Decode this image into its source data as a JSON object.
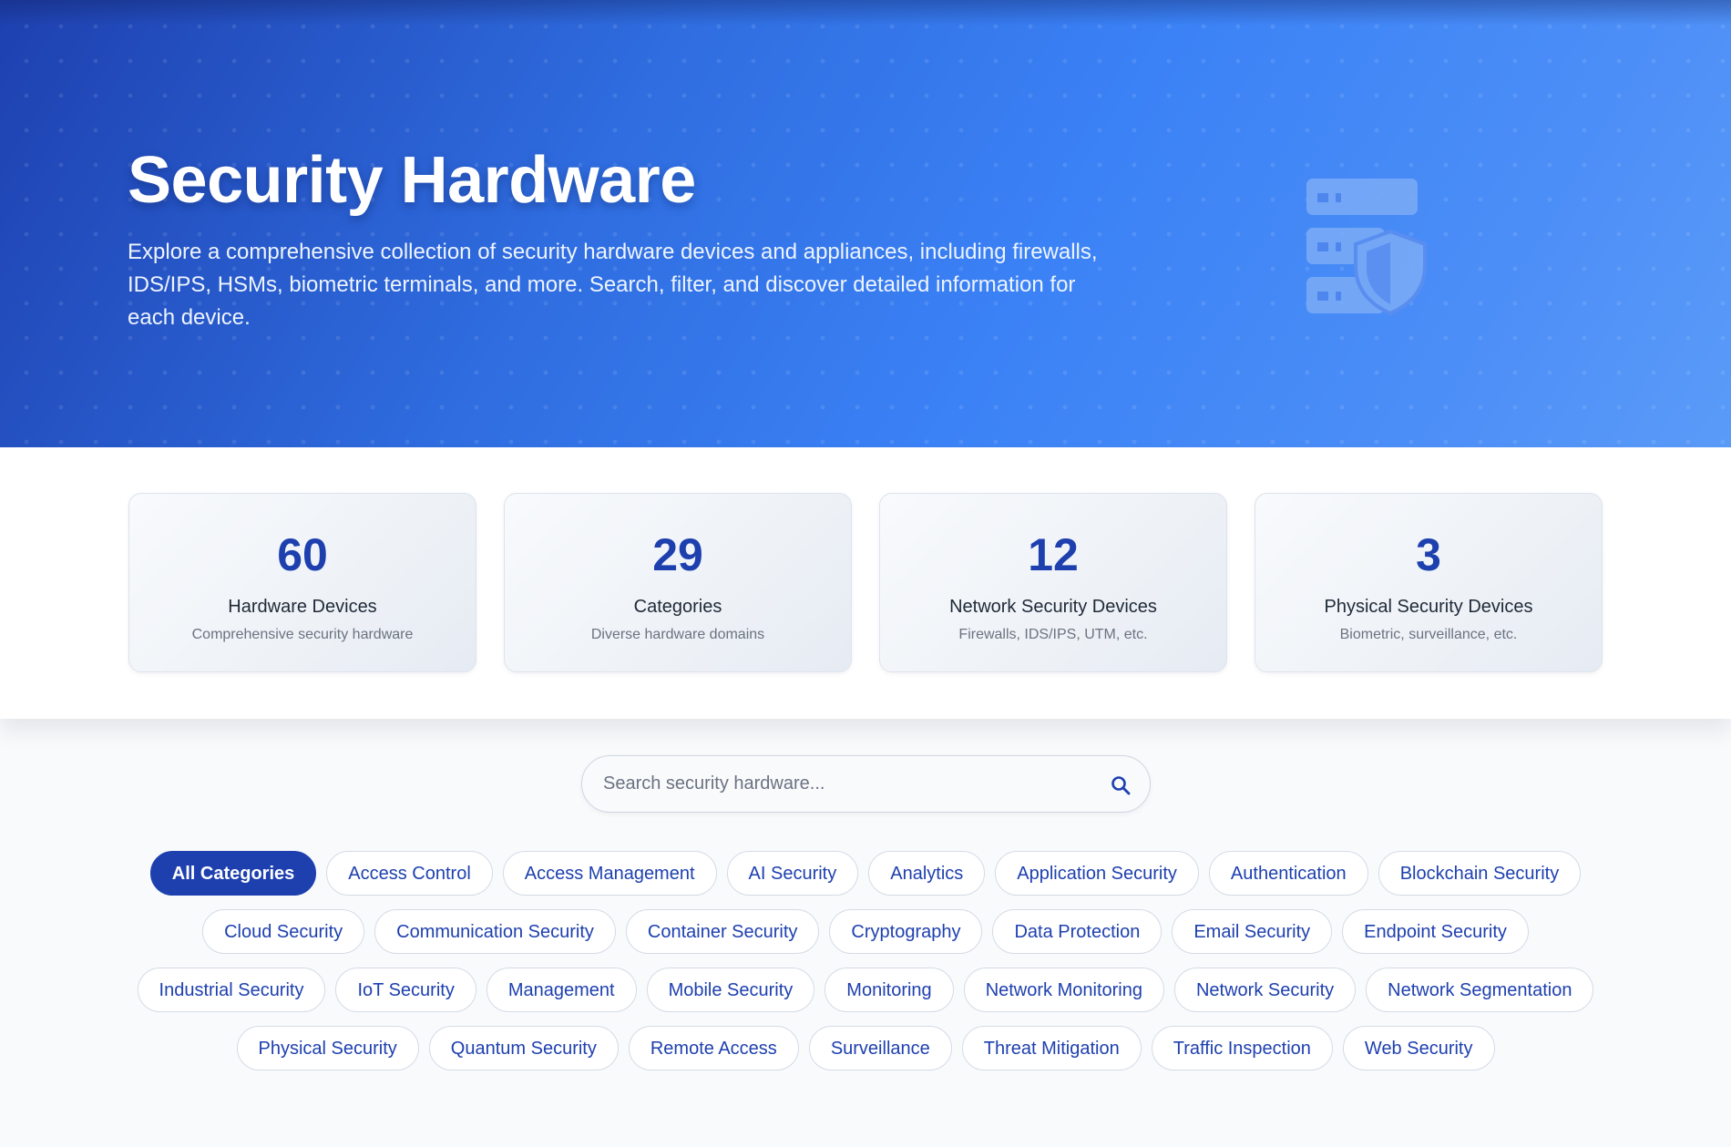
{
  "hero": {
    "title": "Security Hardware",
    "description": "Explore a comprehensive collection of security hardware devices and appliances, including firewalls, IDS/IPS, HSMs, biometric terminals, and more. Search, filter, and discover detailed information for each device.",
    "icon": "server-shield-icon"
  },
  "stats": [
    {
      "number": "60",
      "label": "Hardware Devices",
      "sub": "Comprehensive security hardware"
    },
    {
      "number": "29",
      "label": "Categories",
      "sub": "Diverse hardware domains"
    },
    {
      "number": "12",
      "label": "Network Security Devices",
      "sub": "Firewalls, IDS/IPS, UTM, etc."
    },
    {
      "number": "3",
      "label": "Physical Security Devices",
      "sub": "Biometric, surveillance, etc."
    }
  ],
  "search": {
    "placeholder": "Search security hardware...",
    "value": "",
    "icon": "search-icon"
  },
  "categories": {
    "selected": "All Categories",
    "items": [
      "All Categories",
      "Access Control",
      "Access Management",
      "AI Security",
      "Analytics",
      "Application Security",
      "Authentication",
      "Blockchain Security",
      "Cloud Security",
      "Communication Security",
      "Container Security",
      "Cryptography",
      "Data Protection",
      "Email Security",
      "Endpoint Security",
      "Industrial Security",
      "IoT Security",
      "Management",
      "Mobile Security",
      "Monitoring",
      "Network Monitoring",
      "Network Security",
      "Network Segmentation",
      "Physical Security",
      "Quantum Security",
      "Remote Access",
      "Surveillance",
      "Threat Mitigation",
      "Traffic Inspection",
      "Web Security"
    ]
  },
  "colors": {
    "primary": "#1e40af",
    "hero_gradient_start": "#1e40af",
    "hero_gradient_end": "#5a9bf8",
    "text_dark": "#1f2937",
    "text_muted": "#6b7280"
  }
}
